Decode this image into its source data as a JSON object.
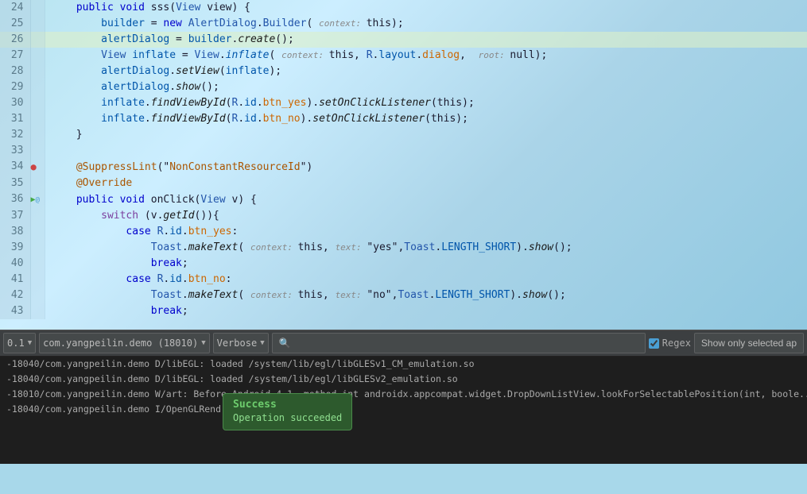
{
  "editor": {
    "lines": [
      {
        "num": 24,
        "gutter": "",
        "content": "    public void sss(View view) {",
        "highlight": false
      },
      {
        "num": 25,
        "gutter": "",
        "content": "        builder = new AlertDialog.Builder( context: this);",
        "highlight": false
      },
      {
        "num": 26,
        "gutter": "",
        "content": "        alertDialog = builder.create();",
        "highlight": true
      },
      {
        "num": 27,
        "gutter": "",
        "content": "        View inflate = View.inflate( context: this, R.layout.dialog,  root: null);",
        "highlight": false
      },
      {
        "num": 28,
        "gutter": "",
        "content": "        alertDialog.setView(inflate);",
        "highlight": false
      },
      {
        "num": 29,
        "gutter": "",
        "content": "        alertDialog.show();",
        "highlight": false
      },
      {
        "num": 30,
        "gutter": "",
        "content": "        inflate.findViewById(R.id.btn_yes).setOnClickListener(this);",
        "highlight": false
      },
      {
        "num": 31,
        "gutter": "",
        "content": "        inflate.findViewById(R.id.btn_no).setOnClickListener(this);",
        "highlight": false
      },
      {
        "num": 32,
        "gutter": "",
        "content": "    }",
        "highlight": false
      },
      {
        "num": 33,
        "gutter": "",
        "content": "",
        "highlight": false
      },
      {
        "num": 34,
        "gutter": "bp",
        "content": "    @SuppressLint(\"NonConstantResourceId\")",
        "highlight": false
      },
      {
        "num": 35,
        "gutter": "",
        "content": "    @Override",
        "highlight": false
      },
      {
        "num": 36,
        "gutter": "run",
        "content": "    public void onClick(View v) {",
        "highlight": false
      },
      {
        "num": 37,
        "gutter": "",
        "content": "        switch (v.getId()){",
        "highlight": false
      },
      {
        "num": 38,
        "gutter": "",
        "content": "            case R.id.btn_yes:",
        "highlight": false
      },
      {
        "num": 39,
        "gutter": "",
        "content": "                Toast.makeText( context: this, text: \"yes\",Toast.LENGTH_SHORT).show();",
        "highlight": false
      },
      {
        "num": 40,
        "gutter": "",
        "content": "                break;",
        "highlight": false
      },
      {
        "num": 41,
        "gutter": "",
        "content": "            case R.id.btn_no:",
        "highlight": false
      },
      {
        "num": 42,
        "gutter": "",
        "content": "                Toast.makeText( context: this, text: \"no\",Toast.LENGTH_SHORT).show();",
        "highlight": false
      },
      {
        "num": 43,
        "gutter": "",
        "content": "                break;",
        "highlight": false
      }
    ]
  },
  "filter_bar": {
    "version_label": "0.1",
    "package_label": "com.yangpeilin.demo (18010)",
    "level_label": "Verbose",
    "search_placeholder": "🔍",
    "regex_label": "Regex",
    "regex_checked": true,
    "show_selected_label": "Show only selected ap"
  },
  "log": {
    "lines": [
      {
        "text": "-18040/com.yangpeilin.demo D/libEGL: loaded /system/lib/egl/libGLESv1_CM_emulation.so"
      },
      {
        "text": "-18040/com.yangpeilin.demo D/libEGL: loaded /system/lib/egl/libGLESv2_emulation.so"
      },
      {
        "text": "-18010/com.yangpeilin.demo W/art: Before Android 4.1, method int androidx.appcompat.widget.DropDownListView.lookForSelectablePosition(int, boole..."
      },
      {
        "text": "-18040/com.yangpeilin.demo I/OpenGLRend..., version 1.4"
      }
    ]
  },
  "success_popup": {
    "title": "Success",
    "message": "Operation succeeded"
  }
}
